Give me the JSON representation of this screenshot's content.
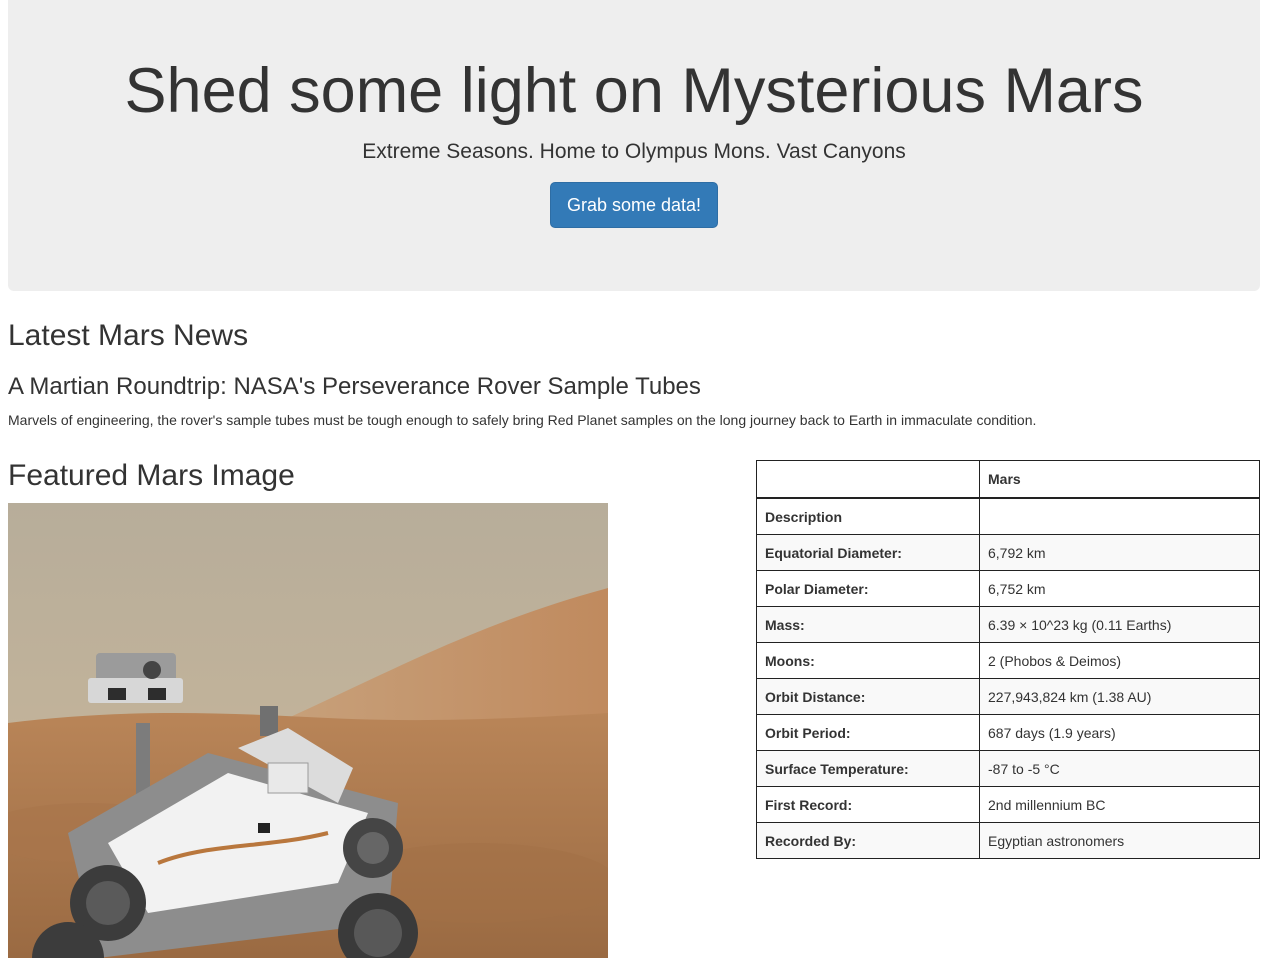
{
  "jumbotron": {
    "title": "Shed some light on Mysterious Mars",
    "subtitle": "Extreme Seasons. Home to Olympus Mons. Vast Canyons",
    "button_label": "Grab some data!"
  },
  "news": {
    "heading": "Latest Mars News",
    "title": "A Martian Roundtrip: NASA's Perseverance Rover Sample Tubes",
    "paragraph": "Marvels of engineering, the rover's sample tubes must be tough enough to safely bring Red Planet samples on the long journey back to Earth in immaculate condition."
  },
  "featured_image": {
    "heading": "Featured Mars Image"
  },
  "facts": {
    "header": [
      "",
      "Mars"
    ],
    "rows": [
      {
        "label": "Description",
        "value": ""
      },
      {
        "label": "Equatorial Diameter:",
        "value": "6,792 km"
      },
      {
        "label": "Polar Diameter:",
        "value": "6,752 km"
      },
      {
        "label": "Mass:",
        "value": "6.39 × 10^23 kg (0.11 Earths)"
      },
      {
        "label": "Moons:",
        "value": "2 (Phobos & Deimos)"
      },
      {
        "label": "Orbit Distance:",
        "value": "227,943,824 km (1.38 AU)"
      },
      {
        "label": "Orbit Period:",
        "value": "687 days (1.9 years)"
      },
      {
        "label": "Surface Temperature:",
        "value": "-87 to -5 °C"
      },
      {
        "label": "First Record:",
        "value": "2nd millennium BC"
      },
      {
        "label": "Recorded By:",
        "value": "Egyptian astronomers"
      }
    ]
  },
  "colors": {
    "jumbotron_bg": "#eeeeee",
    "button_primary": "#337ab7",
    "text": "#333333"
  }
}
